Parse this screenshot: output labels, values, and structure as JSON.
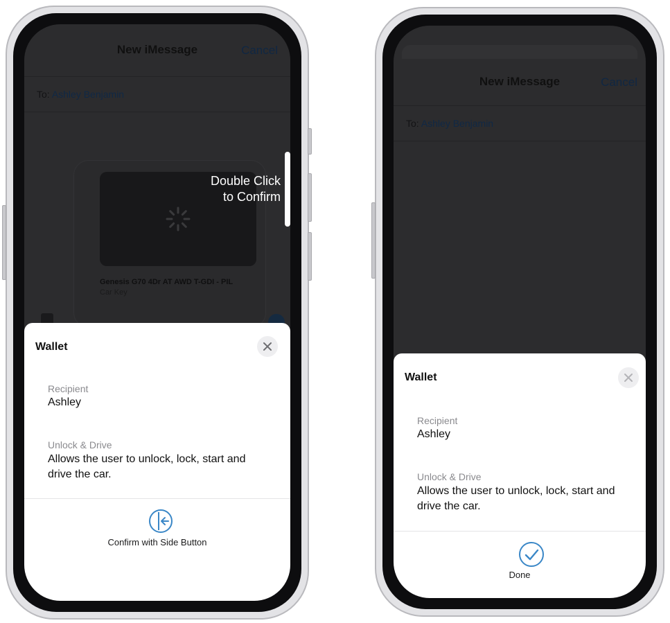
{
  "left": {
    "nav": {
      "title": "New iMessage",
      "cancel": "Cancel"
    },
    "to": {
      "label": "To:",
      "name": "Ashley Benjamin"
    },
    "card": {
      "title": "Genesis G70 4Dr AT AWD T-GDI - PIL",
      "subtitle": "Car Key"
    },
    "overlay": {
      "line1": "Double Click",
      "line2": "to Confirm"
    },
    "sheet": {
      "title": "Wallet",
      "recipient_label": "Recipient",
      "recipient_value": "Ashley",
      "permission_label": "Unlock & Drive",
      "permission_value": "Allows the user to unlock, lock, start and drive the car.",
      "action_label": "Confirm with Side Button",
      "action_icon": "side-button-icon"
    }
  },
  "right": {
    "nav": {
      "title": "New iMessage",
      "cancel": "Cancel"
    },
    "to": {
      "label": "To:",
      "name": "Ashley Benjamin"
    },
    "sheet": {
      "title": "Wallet",
      "recipient_label": "Recipient",
      "recipient_value": "Ashley",
      "permission_label": "Unlock & Drive",
      "permission_value": "Allows the user to unlock, lock, start and drive the car.",
      "action_label": "Done",
      "action_icon": "checkmark-circle-icon"
    }
  },
  "colors": {
    "accent": "#3a87c7",
    "dim_background": "#2c2c2e",
    "sheet": "#ffffff"
  }
}
